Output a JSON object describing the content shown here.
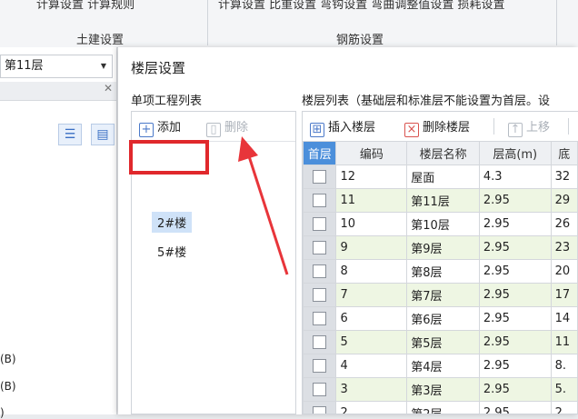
{
  "ribbon": {
    "top_left_clip": "计算设置   计算规则",
    "top_right_clip": "计算设置   比重设置   弯钩设置   弯曲调整值设置   损耗设置",
    "group_civil": "土建设置",
    "group_rebar": "钢筋设置"
  },
  "left_panel": {
    "floor_select_value": "第11层",
    "items": [
      "(B)",
      "(B)",
      ")"
    ]
  },
  "dialog": {
    "title": "楼层设置",
    "project_list": {
      "label": "单项工程列表",
      "add_label": "添加",
      "delete_label": "删除",
      "items": [
        "2#楼",
        "5#楼"
      ],
      "selected_index": 0
    },
    "floor_list": {
      "label": "楼层列表（基础层和标准层不能设置为首层。设",
      "insert_label": "插入楼层",
      "delete_label": "删除楼层",
      "up_label": "上移",
      "columns": [
        "首层",
        "编码",
        "楼层名称",
        "层高(m)",
        "底"
      ],
      "rows": [
        {
          "code": "12",
          "name": "屋面",
          "height": "4.3",
          "base": "32"
        },
        {
          "code": "11",
          "name": "第11层",
          "height": "2.95",
          "base": "29"
        },
        {
          "code": "10",
          "name": "第10层",
          "height": "2.95",
          "base": "26"
        },
        {
          "code": "9",
          "name": "第9层",
          "height": "2.95",
          "base": "23"
        },
        {
          "code": "8",
          "name": "第8层",
          "height": "2.95",
          "base": "20"
        },
        {
          "code": "7",
          "name": "第7层",
          "height": "2.95",
          "base": "17"
        },
        {
          "code": "6",
          "name": "第6层",
          "height": "2.95",
          "base": "14"
        },
        {
          "code": "5",
          "name": "第5层",
          "height": "2.95",
          "base": "11"
        },
        {
          "code": "4",
          "name": "第4层",
          "height": "2.95",
          "base": "8."
        },
        {
          "code": "3",
          "name": "第3层",
          "height": "2.95",
          "base": "5."
        },
        {
          "code": "2",
          "name": "第2层",
          "height": "2.95",
          "base": "2."
        }
      ]
    }
  },
  "colors": {
    "accent": "#4b8fdb",
    "highlight_box": "#e0282c",
    "selected_bg": "#cfe2f8",
    "alt_row": "#eef6e3"
  }
}
